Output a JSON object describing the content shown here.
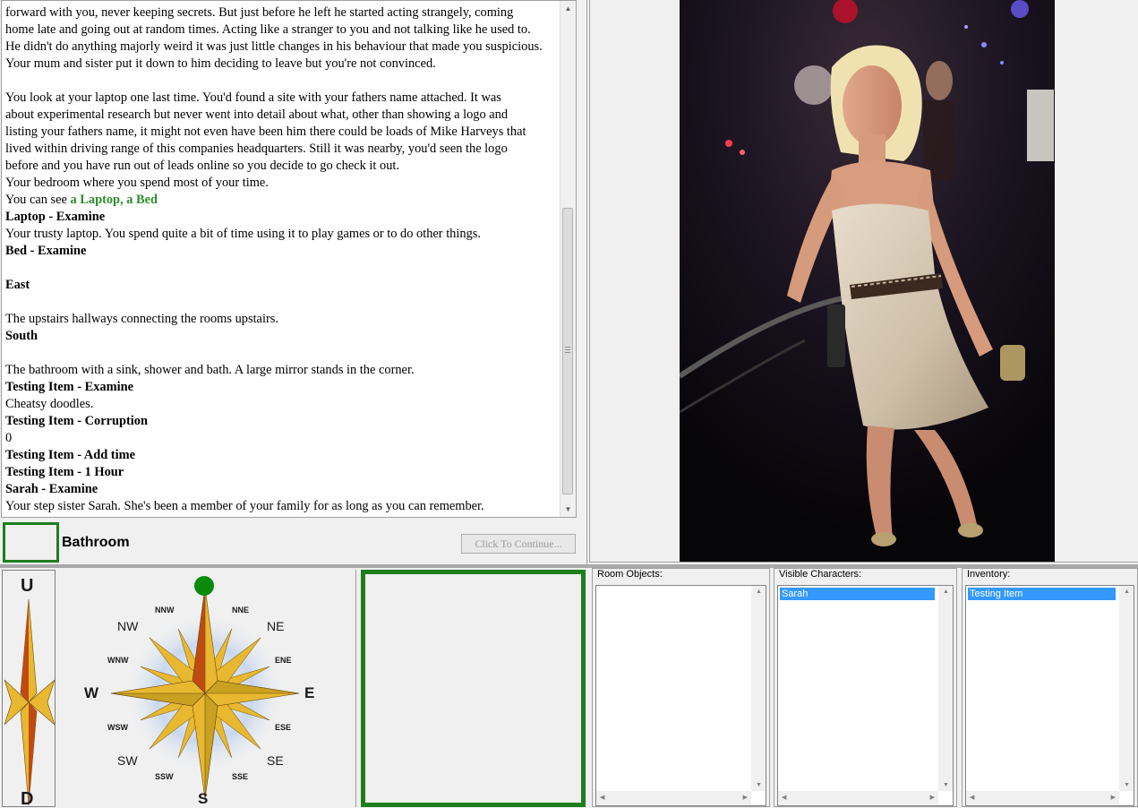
{
  "log": {
    "lines": [
      {
        "text": "forward with you, never keeping secrets. But just before he left he started acting strangely, coming",
        "bold": false
      },
      {
        "text": "home late and going out at random times. Acting like a stranger to you and not talking like he used to.",
        "bold": false
      },
      {
        "text": "He didn't do anything majorly weird it was just little changes in his behaviour that made you suspicious.",
        "bold": false
      },
      {
        "text": "Your mum and sister put it down to him deciding to leave but you're not convinced.",
        "bold": false
      },
      {
        "text": "",
        "bold": false
      },
      {
        "text": "You look at your laptop one last time. You'd found a site with your fathers name attached. It was",
        "bold": false
      },
      {
        "text": "about experimental research but never went into detail about what, other than showing a logo and",
        "bold": false
      },
      {
        "text": "listing your fathers name, it might not even have been him there could be loads of Mike Harveys that",
        "bold": false
      },
      {
        "text": "lived within driving range of this companies headquarters. Still it was nearby, you'd seen the logo",
        "bold": false
      },
      {
        "text": "before and you have run out of leads online so you decide to go check it out.",
        "bold": false
      },
      {
        "text": "Your bedroom where you spend most of your time.",
        "bold": false
      },
      {
        "text": "You can see ",
        "bold": false,
        "link": "a Laptop, a Bed"
      },
      {
        "text": "Laptop - Examine",
        "bold": true
      },
      {
        "text": "Your trusty laptop. You spend quite a bit of time using it to play games or to do other things.",
        "bold": false
      },
      {
        "text": "Bed - Examine",
        "bold": true
      },
      {
        "text": "",
        "bold": false
      },
      {
        "text": "East",
        "bold": true
      },
      {
        "text": "",
        "bold": false
      },
      {
        "text": "The upstairs hallways connecting the rooms upstairs.",
        "bold": false
      },
      {
        "text": "South",
        "bold": true
      },
      {
        "text": "",
        "bold": false
      },
      {
        "text": "The bathroom with a sink, shower and bath. A large mirror stands in the corner.",
        "bold": false
      },
      {
        "text": "Testing Item - Examine",
        "bold": true
      },
      {
        "text": "Cheatsy doodles.",
        "bold": false
      },
      {
        "text": "Testing Item - Corruption",
        "bold": true
      },
      {
        "text": "0",
        "bold": false
      },
      {
        "text": "Testing Item - Add time",
        "bold": true
      },
      {
        "text": "Testing Item - 1 Hour",
        "bold": true
      },
      {
        "text": "Sarah - Examine",
        "bold": true
      },
      {
        "text": "Your step sister Sarah. She's been a member of your family for as long as you can remember.",
        "bold": false
      }
    ]
  },
  "location": {
    "name": "Bathroom"
  },
  "buttons": {
    "continue": "Click To Continue..."
  },
  "compass": {
    "up": "U",
    "down": "D",
    "directions": {
      "n_indicator": "active",
      "nnw": "NNW",
      "nne": "NNE",
      "nw": "NW",
      "ne": "NE",
      "wnw": "WNW",
      "ene": "ENE",
      "w": "W",
      "e": "E",
      "wsw": "WSW",
      "ese": "ESE",
      "sw": "SW",
      "se": "SE",
      "ssw": "SSW",
      "sse": "SSE",
      "s": "S"
    },
    "colors": {
      "active": "#0a8a0a",
      "gold": "#e8b830",
      "rust": "#c04a10"
    }
  },
  "panels": {
    "room_objects": {
      "label": "Room Objects:",
      "items": []
    },
    "visible_characters": {
      "label": "Visible Characters:",
      "items": [
        "Sarah"
      ]
    },
    "inventory": {
      "label": "Inventory:",
      "items": [
        "Testing Item"
      ]
    }
  },
  "colors": {
    "frame_green": "#1e7e1e",
    "selection": "#3399ff",
    "link_green": "#2e8b2e"
  }
}
